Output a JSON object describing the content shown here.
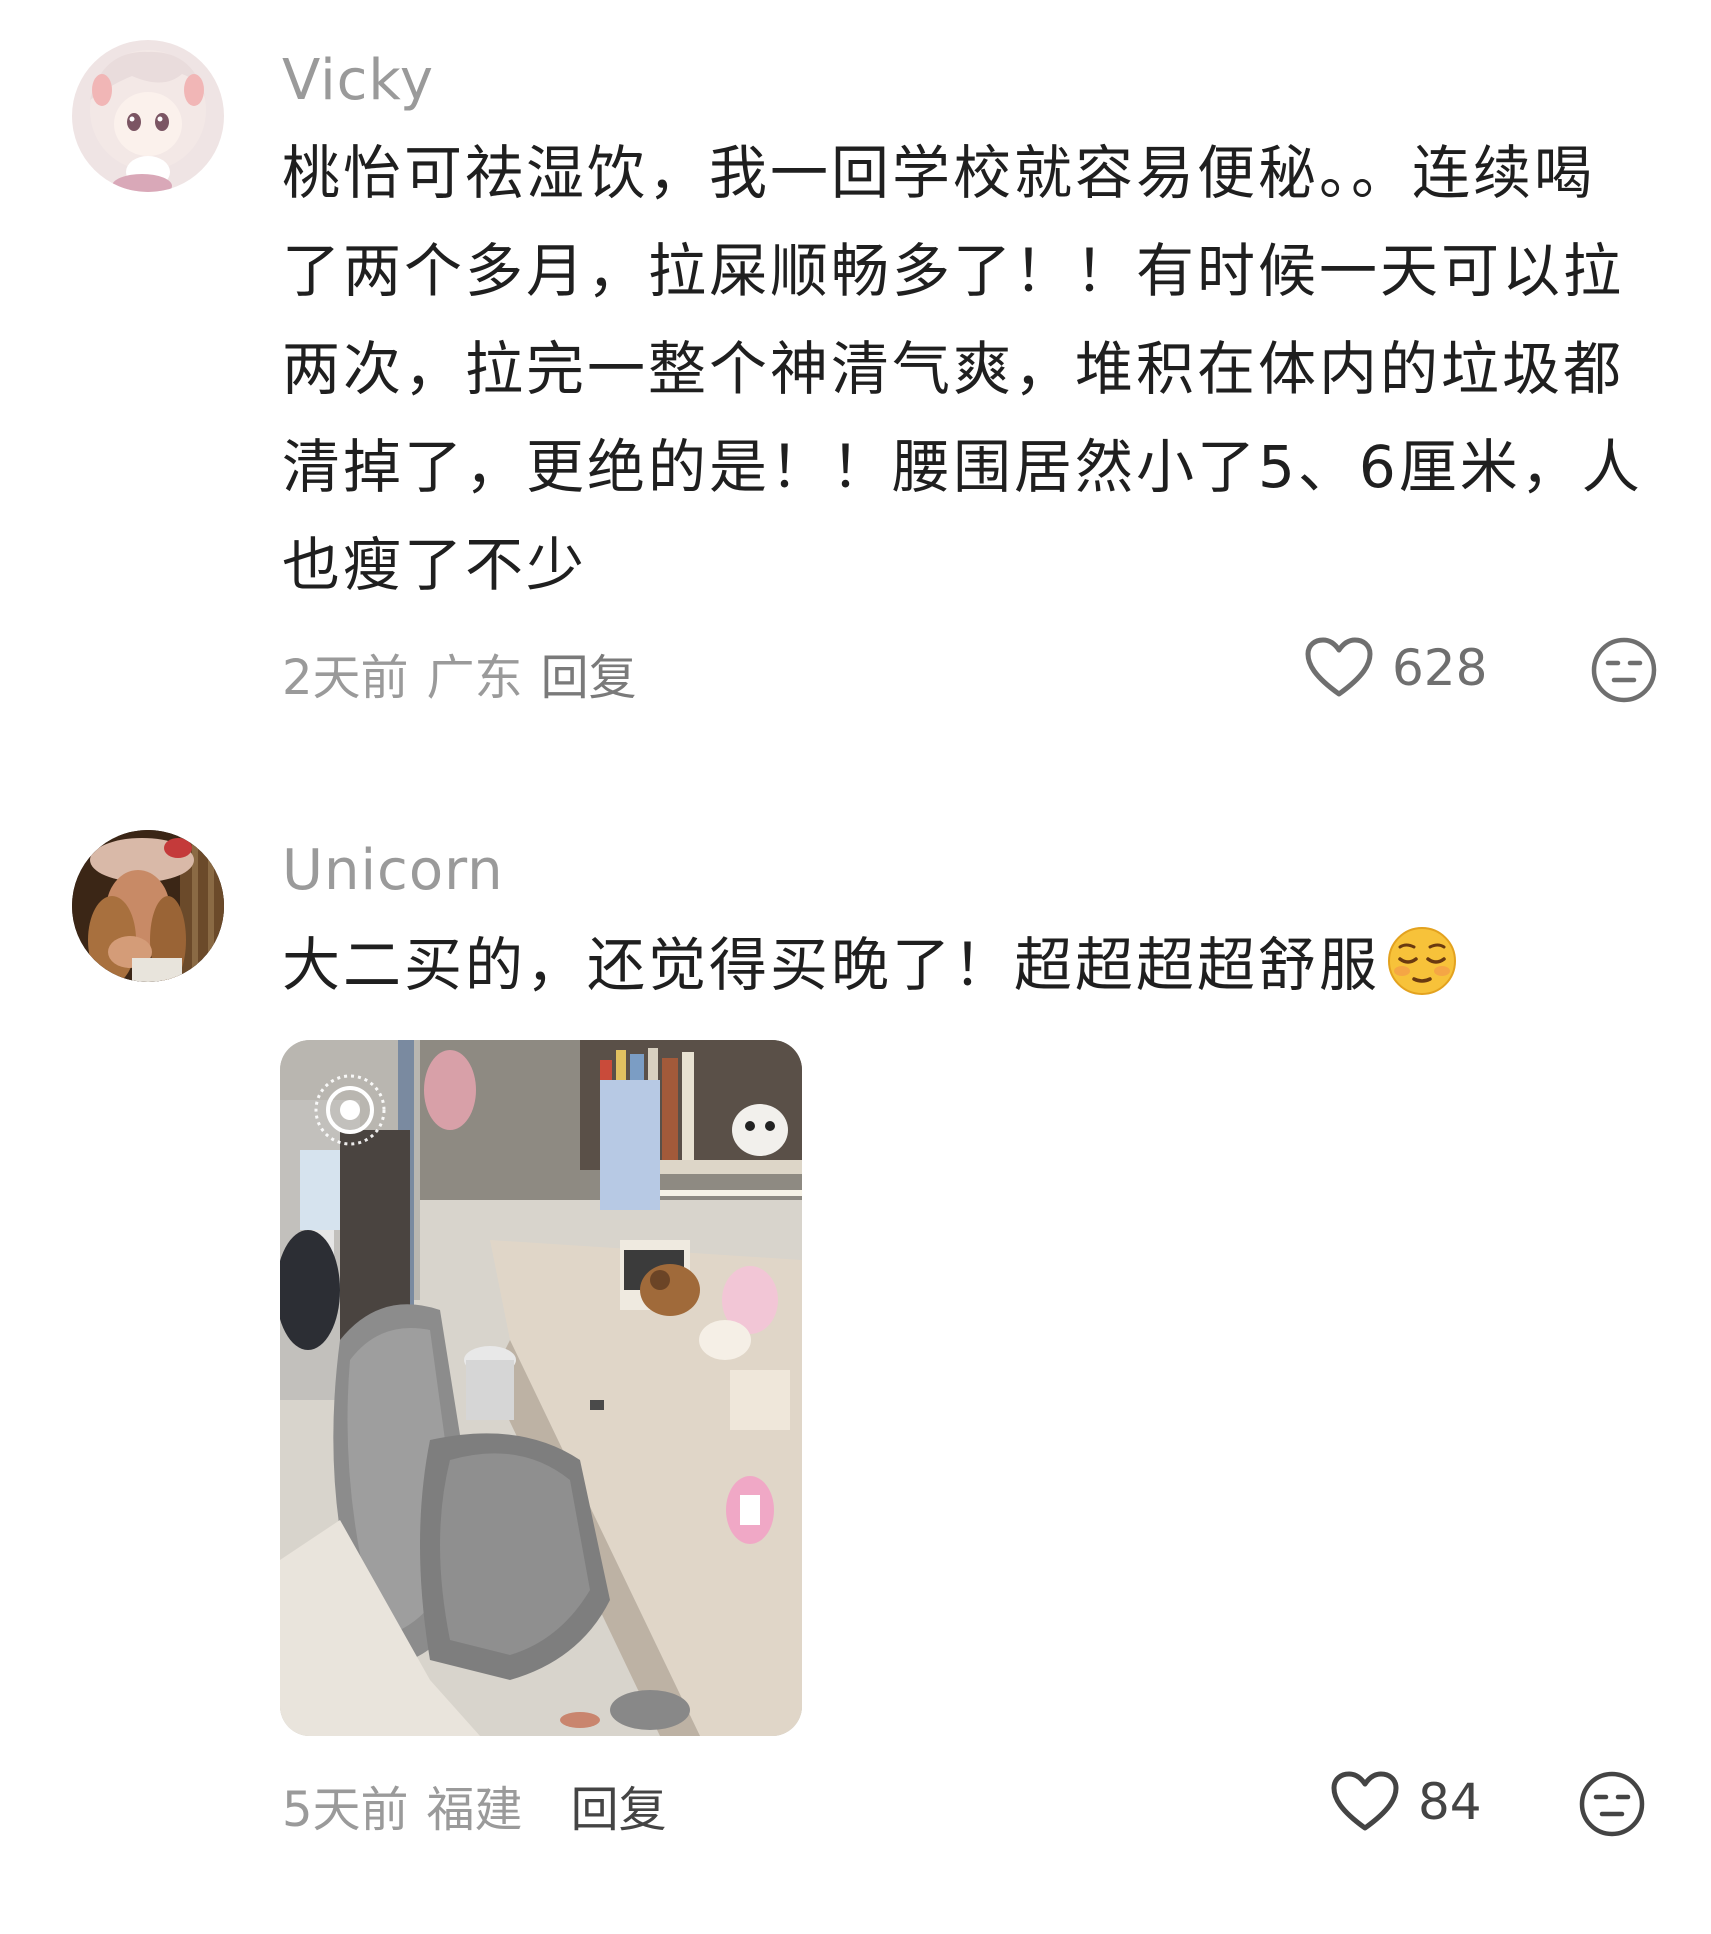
{
  "comments": [
    {
      "username": "Vicky",
      "text": "桃怡可祛湿饮，我一回学校就容易便秘。。连续喝了两个多月，拉屎顺畅多了！！有时候一天可以拉两次，拉完一整个神清气爽，堆积在体内的垃圾都清掉了，更绝的是！！腰围居然小了5、6厘米，人也瘦了不少",
      "time": "2天前",
      "location": "广东",
      "reply_label": "回复",
      "likes": "628",
      "like_icon": "heart-outline-icon",
      "reaction_icon": "neutral-face-icon"
    },
    {
      "username": "Unicorn",
      "text": "大二买的，还觉得买晚了！超超超超舒服",
      "emoji": "relieved-face-emoji",
      "time": "5天前",
      "location": "福建",
      "reply_label": "回复",
      "likes": "84",
      "like_icon": "heart-outline-icon",
      "reaction_icon": "neutral-face-icon",
      "has_photo": true,
      "photo_badge_icon": "live-photo-icon"
    }
  ],
  "colors": {
    "username": "#9a9a9a",
    "text": "#1f1f1f",
    "meta": "#9a9a9a",
    "icon": "#6f6f6f"
  }
}
